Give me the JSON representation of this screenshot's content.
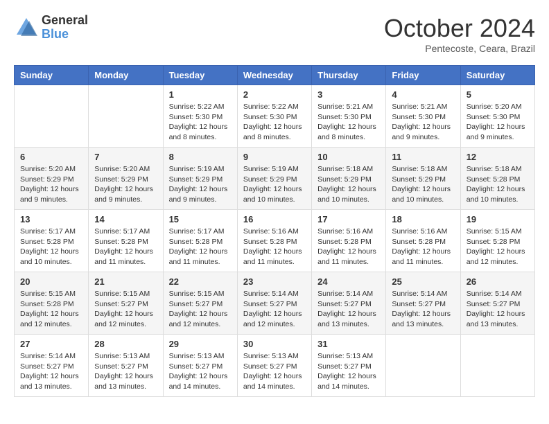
{
  "header": {
    "logo_general": "General",
    "logo_blue": "Blue",
    "month_title": "October 2024",
    "location": "Pentecoste, Ceara, Brazil"
  },
  "days_of_week": [
    "Sunday",
    "Monday",
    "Tuesday",
    "Wednesday",
    "Thursday",
    "Friday",
    "Saturday"
  ],
  "weeks": [
    [
      {
        "day": "",
        "info": ""
      },
      {
        "day": "",
        "info": ""
      },
      {
        "day": "1",
        "info": "Sunrise: 5:22 AM\nSunset: 5:30 PM\nDaylight: 12 hours and 8 minutes."
      },
      {
        "day": "2",
        "info": "Sunrise: 5:22 AM\nSunset: 5:30 PM\nDaylight: 12 hours and 8 minutes."
      },
      {
        "day": "3",
        "info": "Sunrise: 5:21 AM\nSunset: 5:30 PM\nDaylight: 12 hours and 8 minutes."
      },
      {
        "day": "4",
        "info": "Sunrise: 5:21 AM\nSunset: 5:30 PM\nDaylight: 12 hours and 9 minutes."
      },
      {
        "day": "5",
        "info": "Sunrise: 5:20 AM\nSunset: 5:30 PM\nDaylight: 12 hours and 9 minutes."
      }
    ],
    [
      {
        "day": "6",
        "info": "Sunrise: 5:20 AM\nSunset: 5:29 PM\nDaylight: 12 hours and 9 minutes."
      },
      {
        "day": "7",
        "info": "Sunrise: 5:20 AM\nSunset: 5:29 PM\nDaylight: 12 hours and 9 minutes."
      },
      {
        "day": "8",
        "info": "Sunrise: 5:19 AM\nSunset: 5:29 PM\nDaylight: 12 hours and 9 minutes."
      },
      {
        "day": "9",
        "info": "Sunrise: 5:19 AM\nSunset: 5:29 PM\nDaylight: 12 hours and 10 minutes."
      },
      {
        "day": "10",
        "info": "Sunrise: 5:18 AM\nSunset: 5:29 PM\nDaylight: 12 hours and 10 minutes."
      },
      {
        "day": "11",
        "info": "Sunrise: 5:18 AM\nSunset: 5:29 PM\nDaylight: 12 hours and 10 minutes."
      },
      {
        "day": "12",
        "info": "Sunrise: 5:18 AM\nSunset: 5:28 PM\nDaylight: 12 hours and 10 minutes."
      }
    ],
    [
      {
        "day": "13",
        "info": "Sunrise: 5:17 AM\nSunset: 5:28 PM\nDaylight: 12 hours and 10 minutes."
      },
      {
        "day": "14",
        "info": "Sunrise: 5:17 AM\nSunset: 5:28 PM\nDaylight: 12 hours and 11 minutes."
      },
      {
        "day": "15",
        "info": "Sunrise: 5:17 AM\nSunset: 5:28 PM\nDaylight: 12 hours and 11 minutes."
      },
      {
        "day": "16",
        "info": "Sunrise: 5:16 AM\nSunset: 5:28 PM\nDaylight: 12 hours and 11 minutes."
      },
      {
        "day": "17",
        "info": "Sunrise: 5:16 AM\nSunset: 5:28 PM\nDaylight: 12 hours and 11 minutes."
      },
      {
        "day": "18",
        "info": "Sunrise: 5:16 AM\nSunset: 5:28 PM\nDaylight: 12 hours and 11 minutes."
      },
      {
        "day": "19",
        "info": "Sunrise: 5:15 AM\nSunset: 5:28 PM\nDaylight: 12 hours and 12 minutes."
      }
    ],
    [
      {
        "day": "20",
        "info": "Sunrise: 5:15 AM\nSunset: 5:28 PM\nDaylight: 12 hours and 12 minutes."
      },
      {
        "day": "21",
        "info": "Sunrise: 5:15 AM\nSunset: 5:27 PM\nDaylight: 12 hours and 12 minutes."
      },
      {
        "day": "22",
        "info": "Sunrise: 5:15 AM\nSunset: 5:27 PM\nDaylight: 12 hours and 12 minutes."
      },
      {
        "day": "23",
        "info": "Sunrise: 5:14 AM\nSunset: 5:27 PM\nDaylight: 12 hours and 12 minutes."
      },
      {
        "day": "24",
        "info": "Sunrise: 5:14 AM\nSunset: 5:27 PM\nDaylight: 12 hours and 13 minutes."
      },
      {
        "day": "25",
        "info": "Sunrise: 5:14 AM\nSunset: 5:27 PM\nDaylight: 12 hours and 13 minutes."
      },
      {
        "day": "26",
        "info": "Sunrise: 5:14 AM\nSunset: 5:27 PM\nDaylight: 12 hours and 13 minutes."
      }
    ],
    [
      {
        "day": "27",
        "info": "Sunrise: 5:14 AM\nSunset: 5:27 PM\nDaylight: 12 hours and 13 minutes."
      },
      {
        "day": "28",
        "info": "Sunrise: 5:13 AM\nSunset: 5:27 PM\nDaylight: 12 hours and 13 minutes."
      },
      {
        "day": "29",
        "info": "Sunrise: 5:13 AM\nSunset: 5:27 PM\nDaylight: 12 hours and 14 minutes."
      },
      {
        "day": "30",
        "info": "Sunrise: 5:13 AM\nSunset: 5:27 PM\nDaylight: 12 hours and 14 minutes."
      },
      {
        "day": "31",
        "info": "Sunrise: 5:13 AM\nSunset: 5:27 PM\nDaylight: 12 hours and 14 minutes."
      },
      {
        "day": "",
        "info": ""
      },
      {
        "day": "",
        "info": ""
      }
    ]
  ]
}
